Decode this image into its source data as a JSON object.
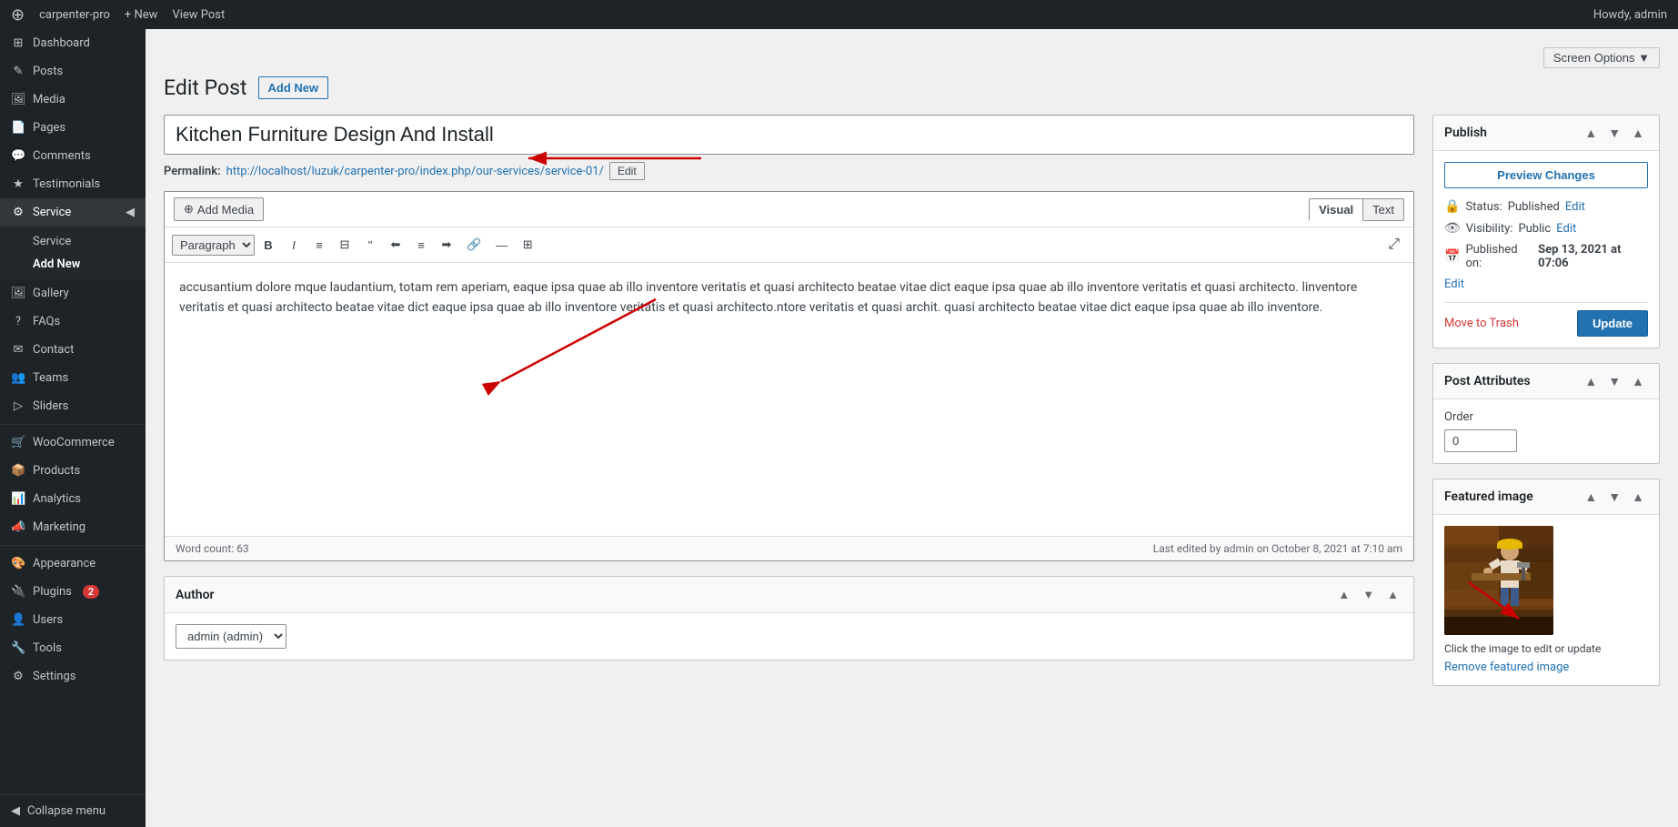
{
  "adminBar": {
    "logo": "⚙",
    "siteName": "carpenter-pro",
    "items": [
      "New",
      "View Post"
    ],
    "rightText": "Howdy, admin"
  },
  "screenOptions": {
    "label": "Screen Options ▼"
  },
  "pageTitle": "Edit Post",
  "addNewLabel": "Add New",
  "postTitle": "Kitchen Furniture Design And Install",
  "permalink": {
    "label": "Permalink:",
    "url": "http://localhost/luzuk/carpenter-pro/index.php/our-services/service-01/",
    "editLabel": "Edit"
  },
  "editor": {
    "addMediaLabel": "Add Media",
    "visualLabel": "Visual",
    "textLabel": "Text",
    "paragraphFormat": "Paragraph",
    "content": "accusantium dolore mque laudantium, totam rem aperiam, eaque ipsa quae ab illo inventore veritatis et quasi architecto beatae vitae dict eaque ipsa quae ab illo inventore veritatis et quasi architecto. linventore veritatis et quasi architecto beatae vitae dict eaque ipsa quae ab illo inventore veritatis et quasi architecto.ntore veritatis et quasi archit. quasi architecto beatae vitae dict eaque ipsa quae ab illo inventore.",
    "wordCount": "Word count: 63",
    "lastEdited": "Last edited by admin on October 8, 2021 at 7:10 am"
  },
  "author": {
    "title": "Author",
    "value": "admin (admin)",
    "options": [
      "admin (admin)"
    ]
  },
  "publish": {
    "title": "Publish",
    "previewChangesLabel": "Preview Changes",
    "statusLabel": "Status:",
    "statusValue": "Published",
    "statusEditLabel": "Edit",
    "visibilityLabel": "Visibility:",
    "visibilityValue": "Public",
    "visibilityEditLabel": "Edit",
    "publishedOnLabel": "Published on:",
    "publishedOnValue": "Sep 13, 2021 at 07:06",
    "publishedOnEditLabel": "Edit",
    "moveToTrashLabel": "Move to Trash",
    "updateLabel": "Update"
  },
  "postAttributes": {
    "title": "Post Attributes",
    "orderLabel": "Order",
    "orderValue": "0"
  },
  "featuredImage": {
    "title": "Featured image",
    "hint": "Click the image to edit or update",
    "removeLinkLabel": "Remove featured image"
  },
  "sidebar": {
    "items": [
      {
        "id": "dashboard",
        "label": "Dashboard",
        "icon": "⊞"
      },
      {
        "id": "posts",
        "label": "Posts",
        "icon": "✎"
      },
      {
        "id": "media",
        "label": "Media",
        "icon": "🖼"
      },
      {
        "id": "pages",
        "label": "Pages",
        "icon": "📄"
      },
      {
        "id": "comments",
        "label": "Comments",
        "icon": "💬"
      },
      {
        "id": "testimonials",
        "label": "Testimonials",
        "icon": "★"
      },
      {
        "id": "service",
        "label": "Service",
        "icon": "⚙",
        "active": true
      },
      {
        "id": "gallery",
        "label": "Gallery",
        "icon": "🖼"
      },
      {
        "id": "faqs",
        "label": "FAQs",
        "icon": "?"
      },
      {
        "id": "contact",
        "label": "Contact",
        "icon": "✉"
      },
      {
        "id": "teams",
        "label": "Teams",
        "icon": "👥"
      },
      {
        "id": "sliders",
        "label": "Sliders",
        "icon": "▷"
      },
      {
        "id": "woocommerce",
        "label": "WooCommerce",
        "icon": "🛒"
      },
      {
        "id": "products",
        "label": "Products",
        "icon": "📦"
      },
      {
        "id": "analytics",
        "label": "Analytics",
        "icon": "📊"
      },
      {
        "id": "marketing",
        "label": "Marketing",
        "icon": "📣"
      },
      {
        "id": "appearance",
        "label": "Appearance",
        "icon": "🎨"
      },
      {
        "id": "plugins",
        "label": "Plugins",
        "icon": "🔌",
        "badge": "2"
      },
      {
        "id": "users",
        "label": "Users",
        "icon": "👤"
      },
      {
        "id": "tools",
        "label": "Tools",
        "icon": "🔧"
      },
      {
        "id": "settings",
        "label": "Settings",
        "icon": "⚙"
      }
    ],
    "serviceSubItems": [
      {
        "id": "service-all",
        "label": "Service"
      },
      {
        "id": "service-add-new",
        "label": "Add New"
      }
    ],
    "collapseLabel": "Collapse menu"
  }
}
